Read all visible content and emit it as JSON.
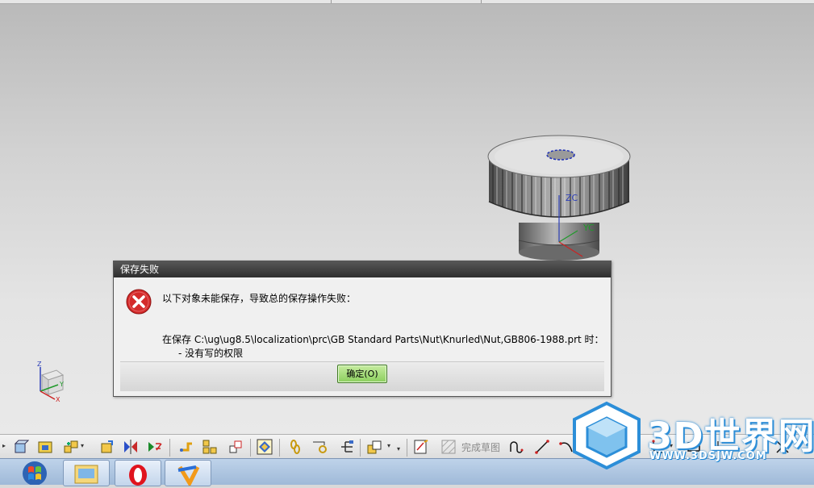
{
  "dialog": {
    "title": "保存失败",
    "message_line1": "以下对象未能保存，导致总的保存操作失败：",
    "message_line2": "在保存 C:\\ug\\ug8.5\\localization\\prc\\GB Standard Parts\\Nut\\Knurled\\Nut,GB806-1988.prt 时：",
    "message_line3": "-   没有写的权限",
    "ok_label": "确定(O)",
    "icon": "error-icon"
  },
  "viewport": {
    "axis_zc": "ZC",
    "axis_yc": "YC",
    "triad_z": "Z",
    "triad_y": "Y",
    "triad_x": "X"
  },
  "toolbar": {
    "finish_sketch_label": "完成草图"
  },
  "watermark": {
    "brand": "3D世界网",
    "url": "WWW.3DSJW.COM"
  },
  "colors": {
    "dialog_title_bg": "#3a3a3a",
    "ok_button": "#9edb74",
    "error_red": "#d42a2a",
    "watermark_blue": "#2c8ed8"
  }
}
